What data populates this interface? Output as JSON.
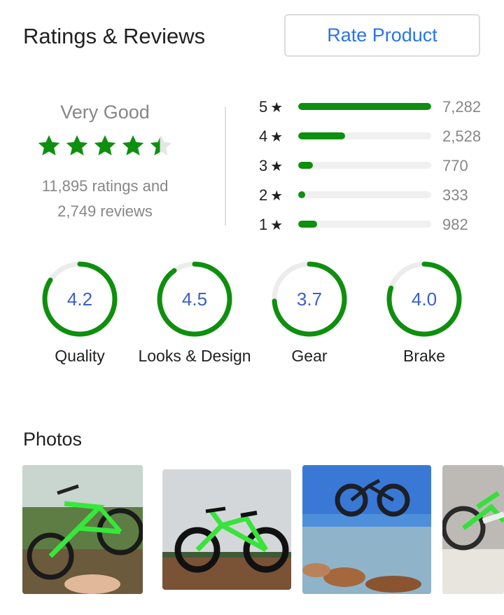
{
  "header": {
    "title": "Ratings & Reviews",
    "rate_button": "Rate Product"
  },
  "summary": {
    "verdict": "Very Good",
    "rating": 4.3,
    "ratings_line": "11,895 ratings and",
    "reviews_line": "2,749 reviews"
  },
  "distribution": [
    {
      "label": "5",
      "count": "7,282",
      "fraction": 1.0
    },
    {
      "label": "4",
      "count": "2,528",
      "fraction": 0.35
    },
    {
      "label": "3",
      "count": "770",
      "fraction": 0.11
    },
    {
      "label": "2",
      "count": "333",
      "fraction": 0.05
    },
    {
      "label": "1",
      "count": "982",
      "fraction": 0.14
    }
  ],
  "aspects": [
    {
      "score": "4.2",
      "name": "Quality",
      "fraction": 0.84
    },
    {
      "score": "4.5",
      "name": "Looks & Design",
      "fraction": 0.9
    },
    {
      "score": "3.7",
      "name": "Gear",
      "fraction": 0.74
    },
    {
      "score": "4.0",
      "name": "Brake",
      "fraction": 0.8
    }
  ],
  "photos": {
    "title": "Photos"
  },
  "colors": {
    "accent": "#2874f0",
    "green": "#0e8f0e",
    "score_blue": "#3a5fcd"
  }
}
